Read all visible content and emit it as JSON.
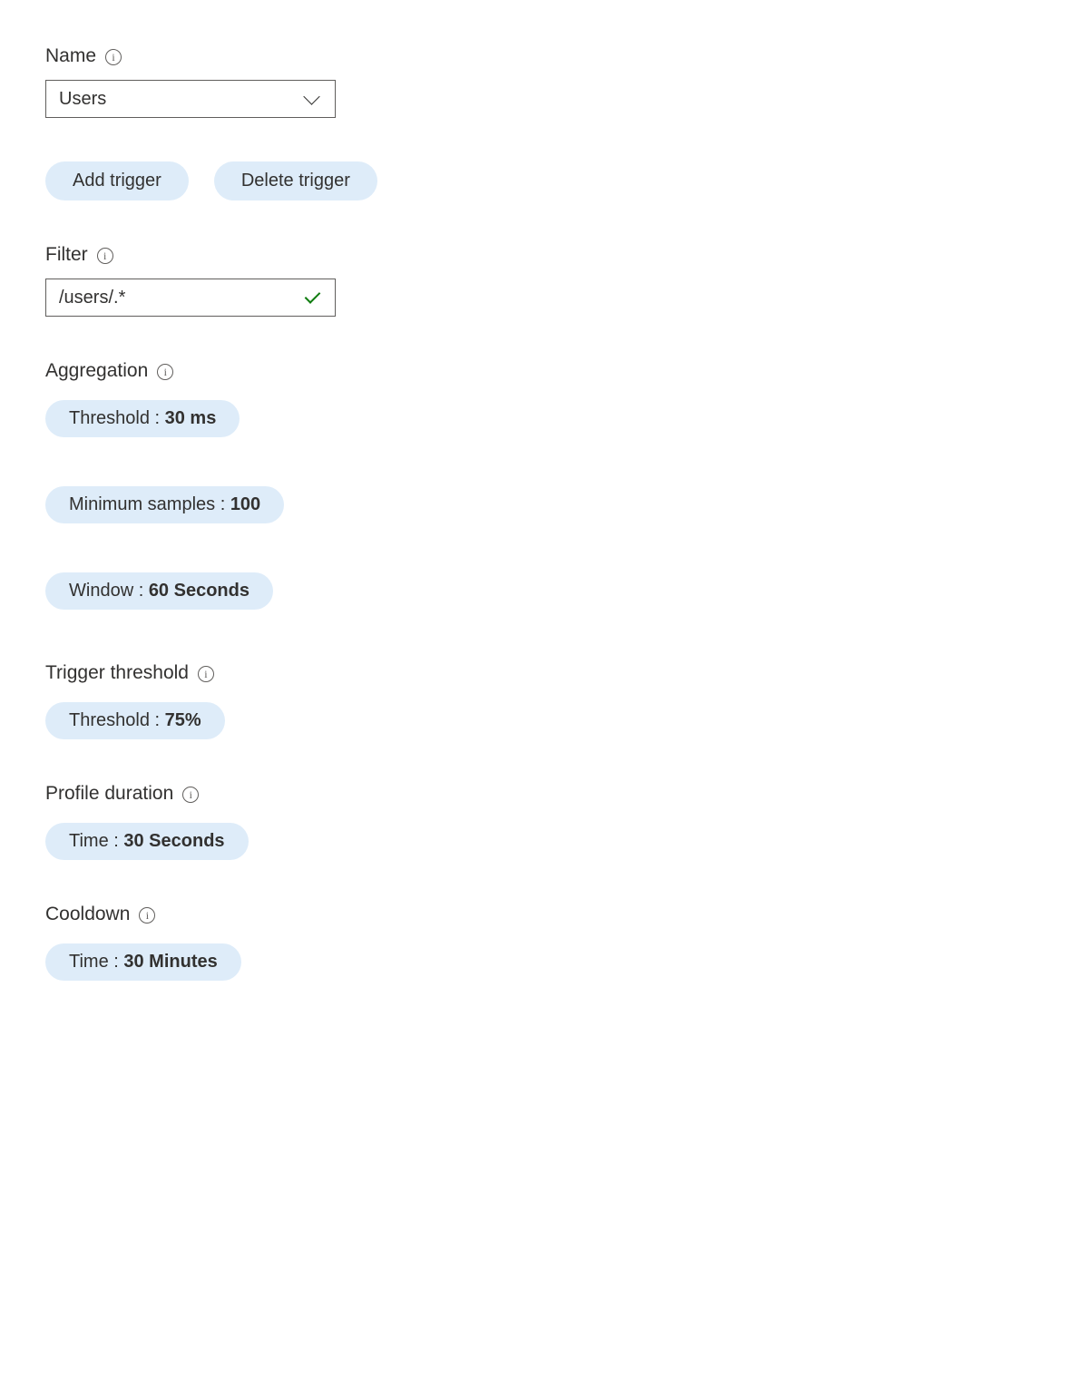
{
  "name": {
    "label": "Name",
    "value": "Users"
  },
  "buttons": {
    "add_trigger": "Add trigger",
    "delete_trigger": "Delete trigger"
  },
  "filter": {
    "label": "Filter",
    "value": "/users/.*"
  },
  "aggregation": {
    "label": "Aggregation",
    "threshold": {
      "label": "Threshold : ",
      "value": "30 ms"
    },
    "min_samples": {
      "label": "Minimum samples : ",
      "value": "100"
    },
    "window": {
      "label": "Window : ",
      "value": "60 Seconds"
    }
  },
  "trigger_threshold": {
    "label": "Trigger threshold",
    "threshold": {
      "label": "Threshold : ",
      "value": "75%"
    }
  },
  "profile_duration": {
    "label": "Profile duration",
    "time": {
      "label": "Time : ",
      "value": "30 Seconds"
    }
  },
  "cooldown": {
    "label": "Cooldown",
    "time": {
      "label": "Time : ",
      "value": "30 Minutes"
    }
  }
}
